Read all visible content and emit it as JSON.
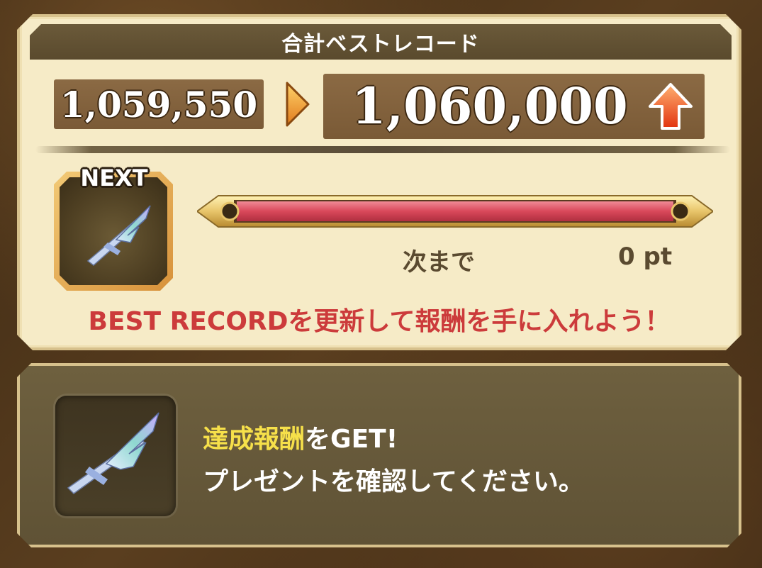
{
  "header": {
    "title": "合計ベストレコード"
  },
  "scores": {
    "previous": "1,059,550",
    "current": "1,060,000"
  },
  "next_reward": {
    "badge": "NEXT",
    "label": "次まで",
    "points": "0 pt",
    "progress_fraction": 1.0
  },
  "message": "BEST RECORDを更新して報酬を手に入れよう！",
  "reward_notice": {
    "highlight": "達成報酬",
    "line1_suffix": "をGET!",
    "line2": "プレゼントを確認してください。"
  },
  "colors": {
    "panel_bg": "#f6ebc7",
    "header_bg": "#5f4f32",
    "score_box": "#7f5f3a",
    "progress_fill": "#d9485a",
    "message_red": "#cc3b3b",
    "highlight_yellow": "#f6e04a"
  },
  "icons": [
    "arrow-right-icon",
    "up-arrow-icon",
    "sword-icon"
  ]
}
